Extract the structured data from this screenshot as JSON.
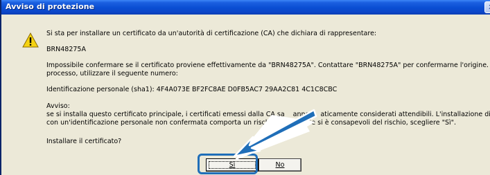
{
  "dialog": {
    "title": "Avviso di protezione",
    "close_label": "x"
  },
  "message": {
    "line1": "Si sta per installare un certificato da un'autorità di certificazione (CA) che dichiara di rappresentare:",
    "ca_name": "BRN48275A",
    "confirm_line1": "Impossibile confermare se il certificato proviene effettivamente da \"BRN48275A\". Contattare \"BRN48275A\" per confermarne l'origine. Per eseguire il",
    "confirm_line2": "processo, utilizzare il seguente numero:",
    "thumbprint": "Identificazione personale (sha1): 4F4A073E BF2FC8AE D0FB5AC7 29AA2C81 4C1C8CBC",
    "warning_heading": "Avviso:",
    "warning_line1": "se si installa questo certificato principale, i certificati emessi dalla CA sa",
    "warning_line1_tail": "anno",
    "warning_line1_end": "aticamente considerati attendibili. L'installazione di un certificato",
    "warning_line2": "con un'identificazione personale non confermata comporta un rischio",
    "warning_line2_end": ". Se si è consapevoli del rischio, scegliere \"Sì\".",
    "question": "Installare il certificato?"
  },
  "buttons": {
    "yes_label": "Sì",
    "no_label": "No"
  },
  "colors": {
    "title_bar": "#0a4ed2",
    "dialog_bg": "#ece9d8",
    "annotation_arrow": "#1f6eb8"
  },
  "icons": {
    "warning": "warning-triangle-icon",
    "close": "close-icon",
    "arrow": "annotation-arrow-icon"
  }
}
